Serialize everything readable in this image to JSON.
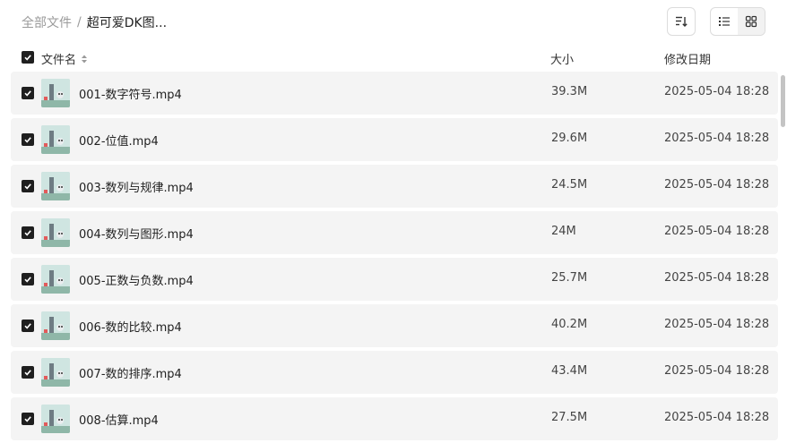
{
  "breadcrumb": {
    "root": "全部文件",
    "separator": "/",
    "current": "超可爱DK图..."
  },
  "toolbar": {
    "sort_icon": "sort-descending-icon",
    "list_icon": "list-view-icon",
    "grid_icon": "grid-view-icon",
    "active_view": "list"
  },
  "header": {
    "name": "文件名",
    "size": "大小",
    "date": "修改日期",
    "sort_icon": "sort-toggle-icon"
  },
  "files": [
    {
      "name": "001-数字符号.mp4",
      "size": "39.3M",
      "date": "2025-05-04 18:28"
    },
    {
      "name": "002-位值.mp4",
      "size": "29.6M",
      "date": "2025-05-04 18:28"
    },
    {
      "name": "003-数列与规律.mp4",
      "size": "24.5M",
      "date": "2025-05-04 18:28"
    },
    {
      "name": "004-数列与图形.mp4",
      "size": "24M",
      "date": "2025-05-04 18:28"
    },
    {
      "name": "005-正数与负数.mp4",
      "size": "25.7M",
      "date": "2025-05-04 18:28"
    },
    {
      "name": "006-数的比较.mp4",
      "size": "40.2M",
      "date": "2025-05-04 18:28"
    },
    {
      "name": "007-数的排序.mp4",
      "size": "43.4M",
      "date": "2025-05-04 18:28"
    },
    {
      "name": "008-估算.mp4",
      "size": "27.5M",
      "date": "2025-05-04 18:28"
    }
  ],
  "colors": {
    "row_bg": "#f4f4f4",
    "checkbox": "#1f1f1f",
    "thumb_bg": "#cfe5e1"
  }
}
